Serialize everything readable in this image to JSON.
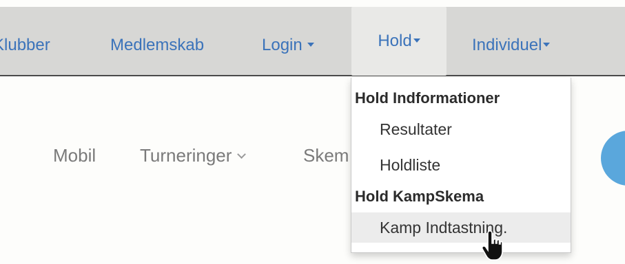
{
  "navbar": {
    "items": [
      {
        "label": "Klubber",
        "caret": false
      },
      {
        "label": "Medlemskab",
        "caret": false
      },
      {
        "label": "Login",
        "caret": true
      },
      {
        "label": "Hold",
        "caret": true,
        "active": true
      },
      {
        "label": "Individuel",
        "caret": true
      }
    ]
  },
  "subnav": {
    "items": [
      {
        "label": "Mobil"
      },
      {
        "label": "Turneringer"
      },
      {
        "label": "Skem"
      }
    ]
  },
  "dropdown": {
    "sections": [
      {
        "header": "Hold Indformationer",
        "items": [
          {
            "label": "Resultater"
          },
          {
            "label": "Holdliste"
          }
        ]
      },
      {
        "header": "Hold KampSkema",
        "items": [
          {
            "label": "Kamp Indtastning.",
            "hovered": true
          }
        ]
      }
    ]
  },
  "colors": {
    "link": "#3b73ba",
    "navbar_bg": "#d7d7d5",
    "active_bg": "#e9e9e7",
    "accent_circle": "#5aa7dc"
  },
  "icons": {
    "caret": "caret-down-icon",
    "chevron": "chevron-down-icon",
    "cursor": "hand-pointer-icon"
  }
}
